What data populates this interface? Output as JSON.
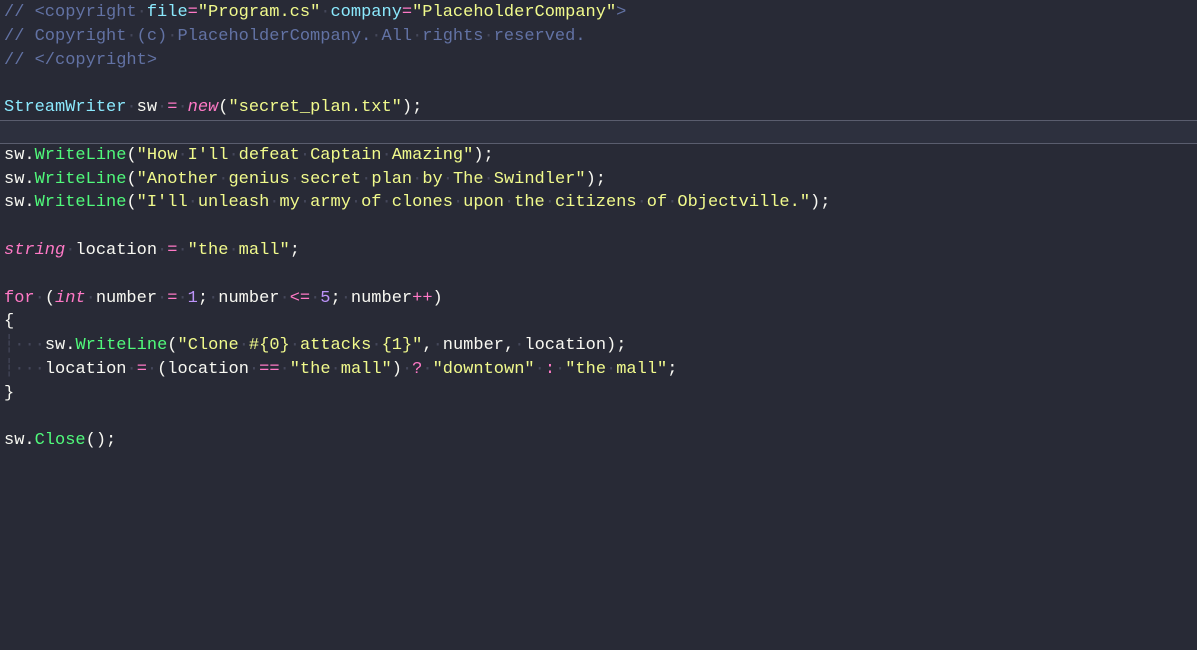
{
  "ws": {
    "dot": "·",
    "ig": "┆"
  },
  "l1": {
    "a": "// ",
    "b": "<copyright",
    "c": "file",
    "d": "=",
    "e": "\"Program.cs\"",
    "f": "company",
    "g": "\"PlaceholderCompany\"",
    "h": ">"
  },
  "l2": {
    "a": "// Copyright (c) PlaceholderCompany. All rights reserved."
  },
  "l3": {
    "a": "// ",
    "b": "</copyright>"
  },
  "l5": {
    "a": "StreamWriter",
    "b": "sw",
    "c": "=",
    "d": "new",
    "e": "(",
    "f": "\"secret_plan.txt\"",
    "g": ")",
    "h": ";"
  },
  "l7": {
    "a": "sw",
    "b": ".",
    "c": "WriteLine",
    "d": "(",
    "e": "\"How I'll defeat Captain Amazing\"",
    "f": ")",
    "g": ";"
  },
  "l8": {
    "a": "sw",
    "b": ".",
    "c": "WriteLine",
    "d": "(",
    "e": "\"Another genius secret plan by The Swindler\"",
    "f": ")",
    "g": ";"
  },
  "l9": {
    "a": "sw",
    "b": ".",
    "c": "WriteLine",
    "d": "(",
    "e": "\"I'll unleash my army of clones upon the citizens of Objectville.\"",
    "f": ")",
    "g": ";"
  },
  "l11": {
    "a": "string",
    "b": "location",
    "c": "=",
    "d": "\"the mall\"",
    "e": ";"
  },
  "l13": {
    "a": "for",
    "b": "(",
    "c": "int",
    "d": "number",
    "e": "=",
    "f": "1",
    "g": ";",
    "h": "number",
    "i": "<=",
    "j": "5",
    "k": ";",
    "l": "number",
    "m": "++",
    "n": ")"
  },
  "l14": {
    "a": "{"
  },
  "l15": {
    "a": "sw",
    "b": ".",
    "c": "WriteLine",
    "d": "(",
    "e": "\"Clone #{0} attacks {1}\"",
    "f": ",",
    "g": "number",
    "h": ",",
    "i": "location",
    "j": ")",
    "k": ";"
  },
  "l16": {
    "a": "location",
    "b": "=",
    "c": "(",
    "d": "location",
    "e": "==",
    "f": "\"the mall\"",
    "g": ")",
    "h": "?",
    "i": "\"downtown\"",
    "j": ":",
    "k": "\"the mall\"",
    "l": ";"
  },
  "l17": {
    "a": "}"
  },
  "l19": {
    "a": "sw",
    "b": ".",
    "c": "Close",
    "d": "()",
    "e": ";"
  }
}
